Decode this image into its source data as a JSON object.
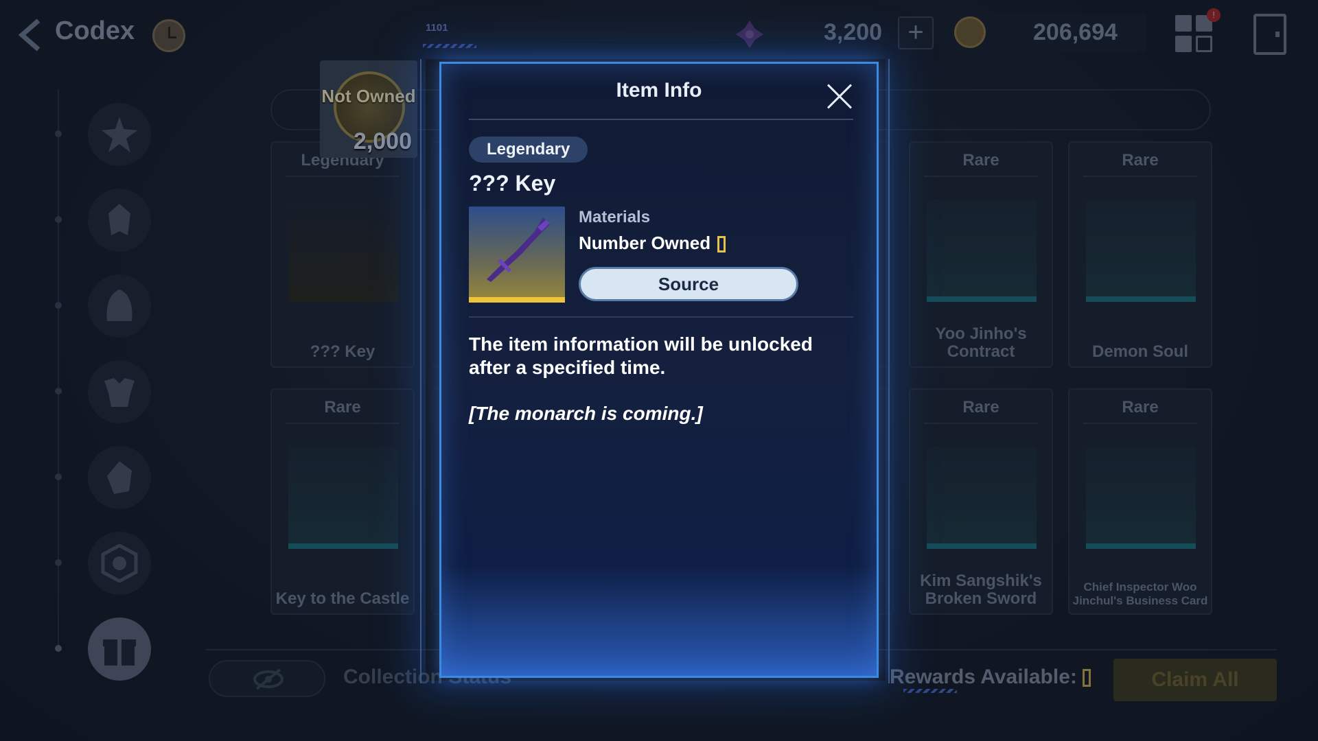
{
  "header": {
    "title": "Codex",
    "ticker": "1101",
    "gems": "3,200",
    "plus": "+",
    "gold": "206,694",
    "notification_badge": "!"
  },
  "not_owned_badge": {
    "label": "Not Owned",
    "price": "2,000"
  },
  "cards": [
    {
      "rarity": "Legendary",
      "name": "??? Key"
    },
    {
      "rarity": "Rare",
      "name": "Yoo Jinho's Contract"
    },
    {
      "rarity": "Rare",
      "name": "Demon Soul"
    },
    {
      "rarity": "Rare",
      "name": "Key to the Castle"
    },
    {
      "rarity": "Rare",
      "name": "Kim Sangshik's Broken Sword"
    },
    {
      "rarity": "Rare",
      "name": "Chief Inspector Woo Jinchul's Business Card"
    }
  ],
  "bottom": {
    "collection_label": "Collection Status",
    "rewards_label": "Rewards Available:",
    "claim_label": "Claim All"
  },
  "modal": {
    "title": "Item Info",
    "rarity": "Legendary",
    "item_name": "??? Key",
    "item_type": "Materials",
    "owned_label": "Number Owned",
    "source_label": "Source",
    "description": "The item information will be unlocked after a specified time.",
    "flavor": "[The monarch is coming.]"
  },
  "colors": {
    "modal_border": "#3c8ae0",
    "legendary_accent": "#f0c43a",
    "rare_accent": "#1e6e7a"
  }
}
